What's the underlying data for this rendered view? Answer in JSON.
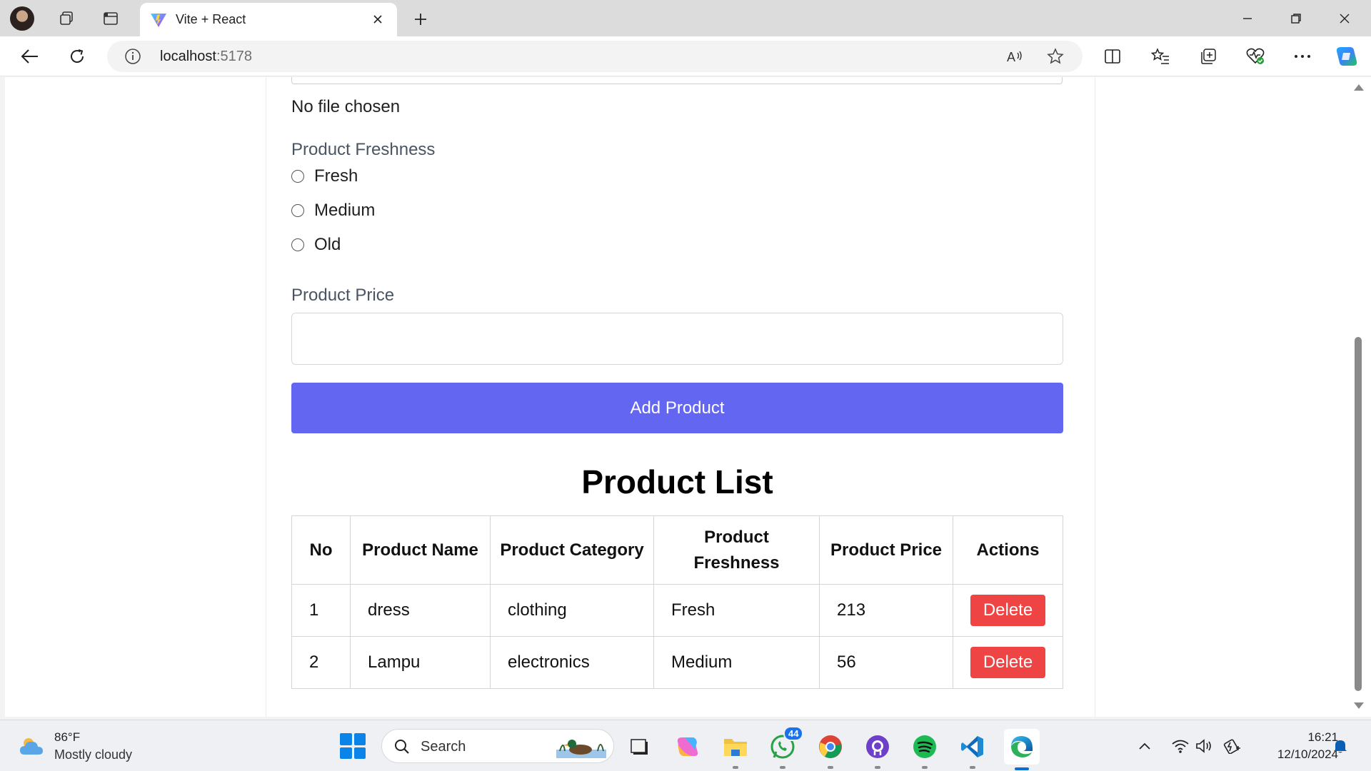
{
  "browser": {
    "tab_title": "Vite + React",
    "url_host": "localhost",
    "url_port": ":5178"
  },
  "form": {
    "file_status": "No file chosen",
    "freshness_label": "Product Freshness",
    "freshness_options": [
      "Fresh",
      "Medium",
      "Old"
    ],
    "price_label": "Product Price",
    "price_value": "",
    "submit_label": "Add Product"
  },
  "product_list": {
    "title": "Product List",
    "headers": [
      "No",
      "Product Name",
      "Product Category",
      "Product Freshness",
      "Product Price",
      "Actions"
    ],
    "rows": [
      {
        "no": "1",
        "name": "dress",
        "category": "clothing",
        "freshness": "Fresh",
        "price": "213",
        "action": "Delete"
      },
      {
        "no": "2",
        "name": "Lampu",
        "category": "electronics",
        "freshness": "Medium",
        "price": "56",
        "action": "Delete"
      }
    ]
  },
  "colors": {
    "primary_button": "#6366f1",
    "delete_button": "#ef4444"
  },
  "taskbar": {
    "weather_temp": "86°F",
    "weather_desc": "Mostly cloudy",
    "search_placeholder": "Search",
    "whatsapp_badge": "44",
    "time": "16:21",
    "date": "12/10/2024"
  }
}
